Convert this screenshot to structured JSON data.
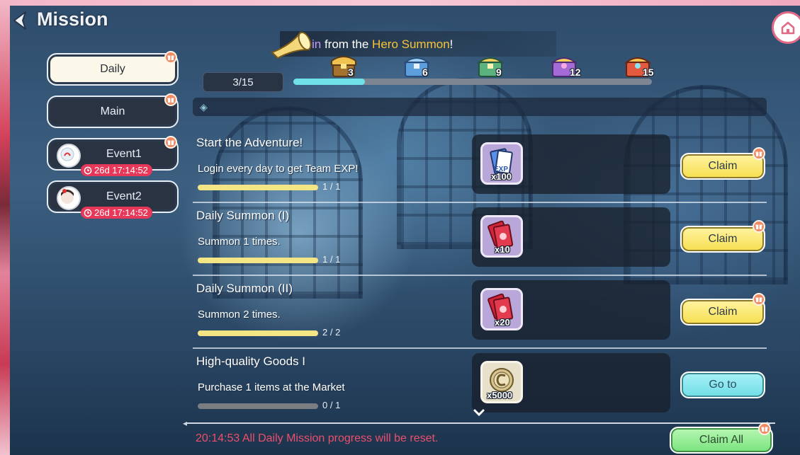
{
  "header": {
    "title": "Mission",
    "back_icon": "back-arrow-icon",
    "home_icon": "home-icon"
  },
  "tabs": [
    {
      "label": "Daily",
      "state": "active"
    },
    {
      "label": "Main",
      "state": "inactive"
    },
    {
      "label": "Event1",
      "timer": "26d 17:14:52"
    },
    {
      "label": "Event2",
      "timer": "26d 17:14:52"
    }
  ],
  "banner": {
    "prefix": "in",
    "middle": " from the ",
    "highlight": "Hero Summon",
    "suffix": "!"
  },
  "progress": {
    "count_text": "3/15",
    "value": 3,
    "max": 15,
    "milestones": [
      "3",
      "6",
      "9",
      "12",
      "15"
    ]
  },
  "missions": [
    {
      "title": "Start the Adventure!",
      "desc": "Login every day to get Team EXP!",
      "progress_text": "1 / 1",
      "progress": 1.0,
      "reward_icon": "exp-ticket-icon",
      "reward_qty": "x100",
      "action": "Claim"
    },
    {
      "title": "Daily Summon (I)",
      "desc": "Summon 1 times.",
      "progress_text": "1 / 1",
      "progress": 1.0,
      "reward_icon": "summon-ticket-icon",
      "reward_qty": "x10",
      "action": "Claim"
    },
    {
      "title": "Daily Summon (II)",
      "desc": "Summon 2 times.",
      "progress_text": "2 / 2",
      "progress": 1.0,
      "reward_icon": "summon-ticket-icon",
      "reward_qty": "x20",
      "action": "Claim"
    },
    {
      "title": "High-quality Goods I",
      "desc": "Purchase 1 items at the Market",
      "progress_text": "0 / 1",
      "progress": 0.0,
      "reward_icon": "coin-icon",
      "reward_qty": "x5000",
      "action": "Go to"
    }
  ],
  "footer": {
    "reset_text": "20:14:53 All Daily Mission progress will be reset.",
    "claim_all_label": "Claim All"
  },
  "colors": {
    "claim": "#f6df4f",
    "goto": "#6fdde7",
    "claim_all": "#78e27c",
    "reset_text": "#ec4f6e",
    "highlight": "#f7c437"
  }
}
